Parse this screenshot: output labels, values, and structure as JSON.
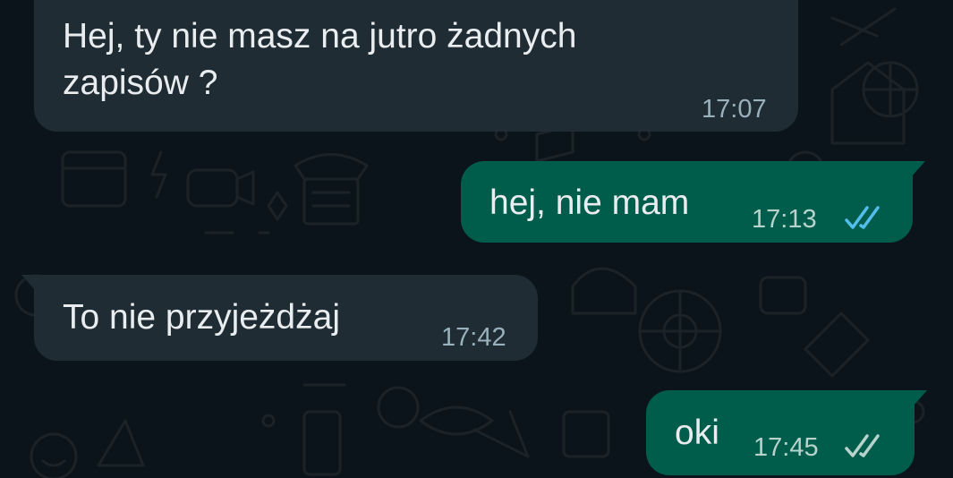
{
  "messages": [
    {
      "direction": "incoming",
      "text": "Hej, ty nie masz na jutro żadnych\nzapisów ?",
      "time": "17:07"
    },
    {
      "direction": "outgoing",
      "text": "hej, nie mam",
      "time": "17:13",
      "status": "read",
      "tick_color": "#53bdeb"
    },
    {
      "direction": "incoming",
      "text": "To nie przyjeżdżaj",
      "time": "17:42"
    },
    {
      "direction": "outgoing",
      "text": "oki",
      "time": "17:45",
      "status": "delivered",
      "tick_color": "#b6d3cc"
    }
  ],
  "colors": {
    "background": "#0b141a",
    "incoming_bubble": "#1f2c34",
    "outgoing_bubble": "#005c4b",
    "text": "#e9edef"
  }
}
